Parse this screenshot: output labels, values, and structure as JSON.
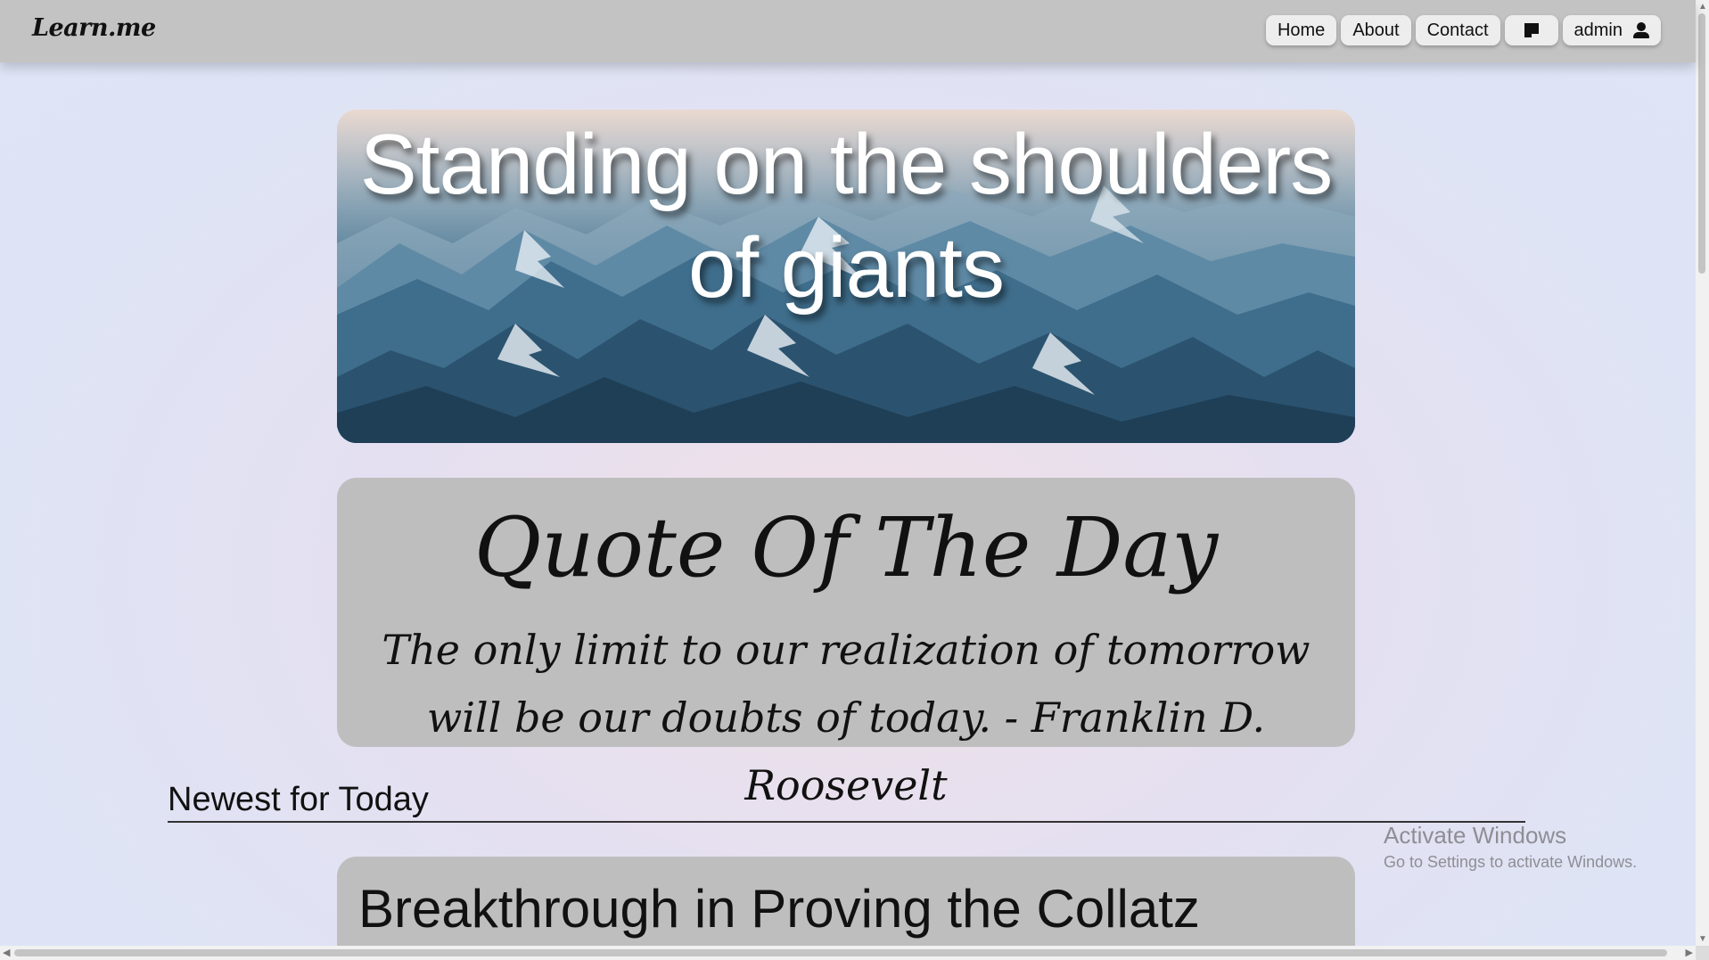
{
  "navbar": {
    "brand": "Learn.me",
    "items": [
      {
        "label": "Home"
      },
      {
        "label": "About"
      },
      {
        "label": "Contact"
      }
    ],
    "notes_icon": "sticky-note-icon",
    "user": {
      "label": "admin",
      "icon": "user-icon"
    }
  },
  "hero": {
    "title": "Standing on the shoulders of giants",
    "image": "snowy-mountain-range"
  },
  "quote": {
    "heading": "Quote Of The Day",
    "text": "The only limit to our realization of tomorrow will be our doubts of today. - Franklin D. Roosevelt"
  },
  "newest": {
    "heading": "Newest for Today",
    "articles": [
      {
        "title": "Breakthrough in Proving the Collatz"
      }
    ]
  },
  "watermark": {
    "line1": "Activate Windows",
    "line2": "Go to Settings to activate Windows."
  }
}
